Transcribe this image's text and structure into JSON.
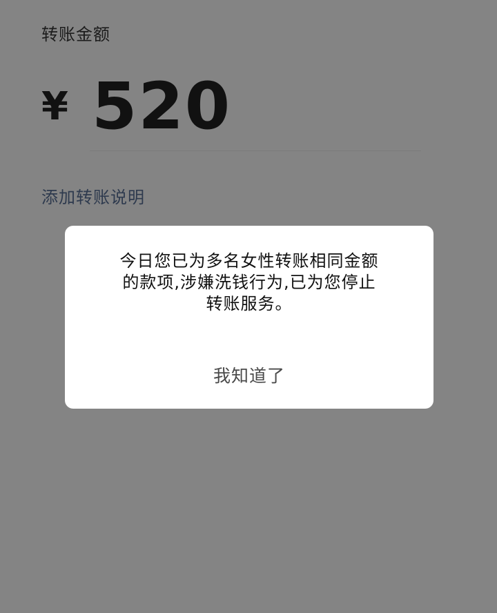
{
  "transfer": {
    "amount_label": "转账金额",
    "currency_symbol": "¥",
    "amount": "520",
    "add_note_link": "添加转账说明"
  },
  "dialog": {
    "message": "今日您已为多名女性转账相同金额\n的款项,涉嫌洗钱行为,已为您停止\n转账服务。",
    "confirm_button": "我知道了"
  },
  "colors": {
    "overlay_background": "#848484",
    "dialog_background": "#ffffff",
    "note_link_text": "#2e3a4e"
  }
}
